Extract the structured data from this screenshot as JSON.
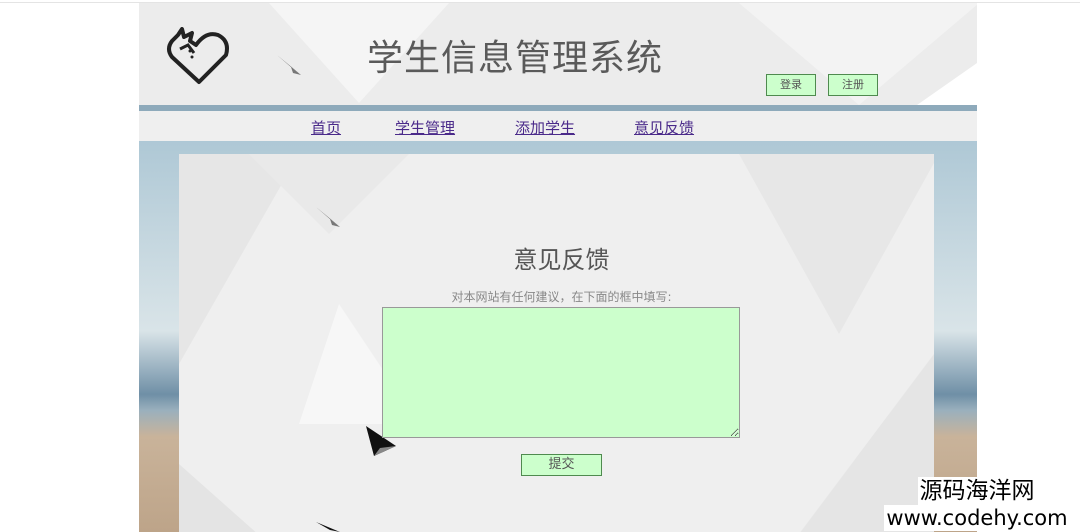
{
  "header": {
    "site_title": "学生信息管理系统",
    "login_label": "登录",
    "register_label": "注册"
  },
  "nav": {
    "items": [
      {
        "label": "首页"
      },
      {
        "label": "学生管理"
      },
      {
        "label": "添加学生"
      },
      {
        "label": "意见反馈"
      }
    ]
  },
  "feedback": {
    "heading": "意见反馈",
    "prompt": "对本网站有任何建议，在下面的框中填写:",
    "textarea_value": "",
    "submit_label": "提交"
  },
  "watermark": {
    "line1": "源码海洋网",
    "line2": "www.codehy.com"
  },
  "colors": {
    "button_bg": "#ccffcc",
    "link": "#4a2a8a",
    "header_bar": "#8eaabb"
  }
}
